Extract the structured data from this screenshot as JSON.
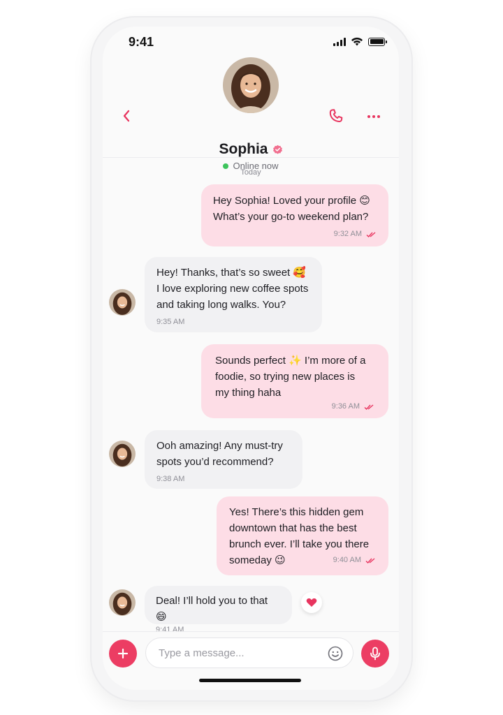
{
  "status_bar": {
    "time": "9:41"
  },
  "header": {
    "name": "Sophia",
    "status": "Online now",
    "icons": {
      "back": "chevron-left-icon",
      "call": "phone-icon",
      "more": "more-horizontal-icon",
      "verified": "verified-badge-icon"
    }
  },
  "chat": {
    "day_label": "Today",
    "messages": [
      {
        "direction": "outgoing",
        "lines": [
          "Hey Sophia! Loved your profile 😊",
          "What’s your go-to weekend plan?"
        ],
        "time": "9:32 AM",
        "read": true
      },
      {
        "direction": "incoming",
        "lines": [
          "Hey! Thanks, that’s so sweet 🥰",
          "I love exploring new coffee spots",
          "and taking long walks. You?"
        ],
        "time": "9:35 AM"
      },
      {
        "direction": "outgoing",
        "lines": [
          "Sounds perfect ✨ I’m more of a",
          "foodie, so trying new places is",
          "my thing haha"
        ],
        "time": "9:36 AM",
        "read": true
      },
      {
        "direction": "incoming",
        "lines": [
          "Ooh amazing! Any must-try",
          "spots you’d recommend?"
        ],
        "time": "9:38 AM"
      },
      {
        "direction": "outgoing",
        "lines": [
          "Yes! There’s this hidden gem",
          "downtown that has the best",
          "brunch ever. I’ll take you there",
          "someday 😉"
        ],
        "time": "9:40 AM",
        "read": true
      },
      {
        "direction": "incoming",
        "lines": [
          "Deal! I’ll hold you to that 😄"
        ],
        "time": "9:41 AM",
        "reaction": "heart-icon"
      }
    ]
  },
  "composer": {
    "placeholder": "Type a message...",
    "icons": {
      "add": "plus-icon",
      "emoji": "smiley-icon",
      "voice": "microphone-icon"
    }
  },
  "colors": {
    "accent": "#EC3D63",
    "outgoing_bubble": "#FDDDE6",
    "incoming_bubble": "#F1F1F3",
    "online": "#3DC45C"
  }
}
